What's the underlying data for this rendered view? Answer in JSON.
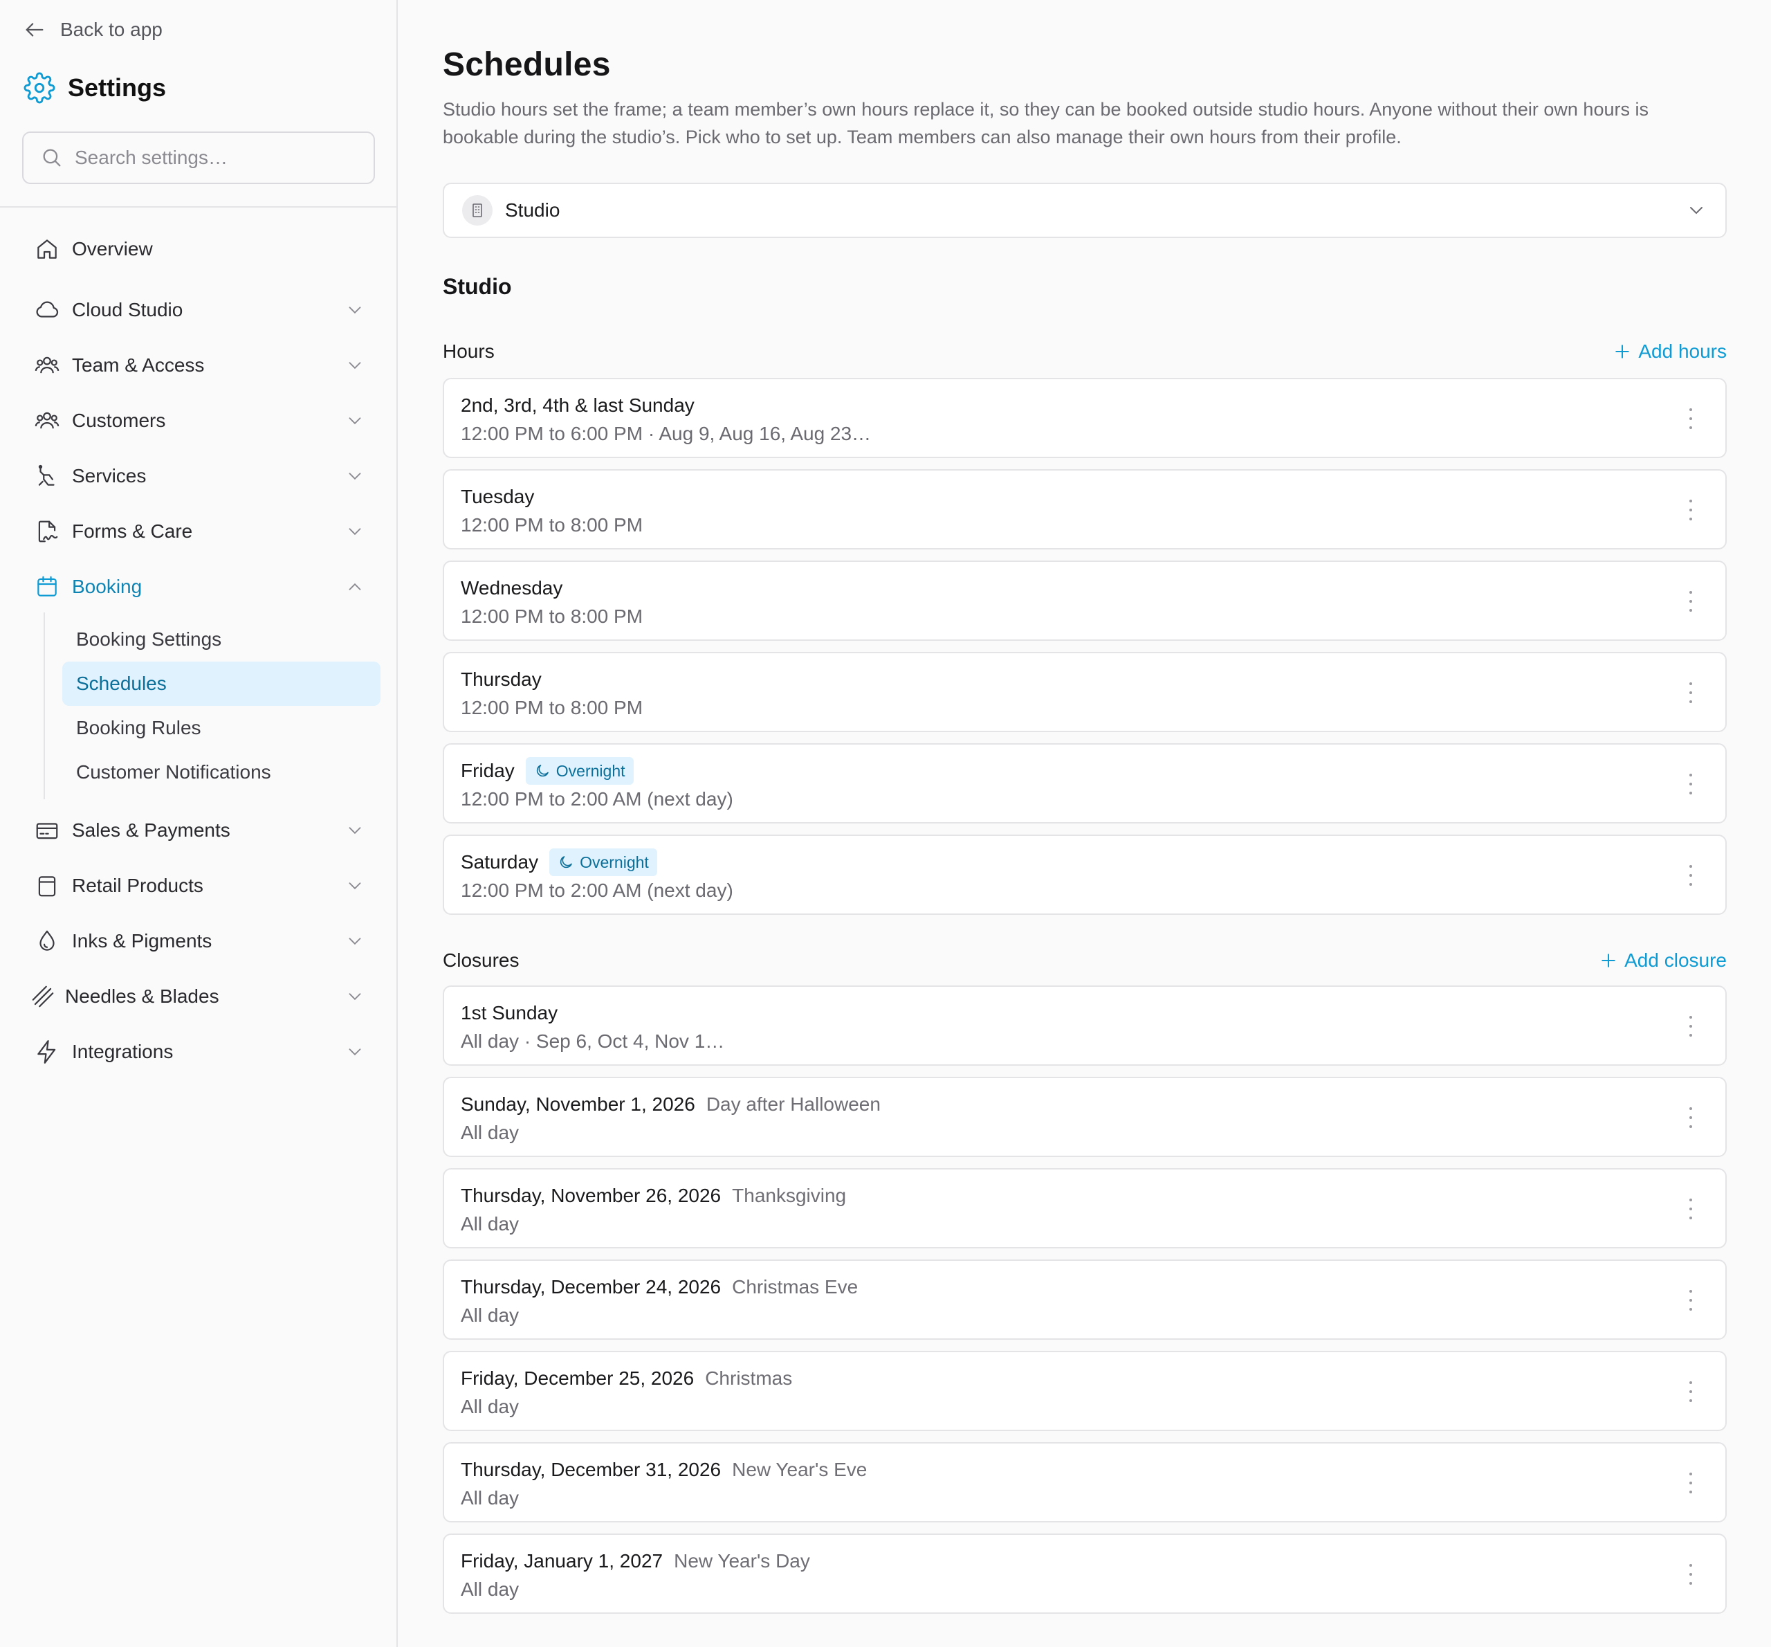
{
  "sidebar": {
    "back_label": "Back to app",
    "title": "Settings",
    "search_placeholder": "Search settings…",
    "items": [
      {
        "label": "Overview",
        "icon": "home-icon",
        "expandable": false
      },
      {
        "label": "Cloud Studio",
        "icon": "cloud-icon",
        "expandable": true
      },
      {
        "label": "Team & Access",
        "icon": "users-icon",
        "expandable": true
      },
      {
        "label": "Customers",
        "icon": "users-icon",
        "expandable": true
      },
      {
        "label": "Services",
        "icon": "tattoo-machine-icon",
        "expandable": true
      },
      {
        "label": "Forms & Care",
        "icon": "file-signature-icon",
        "expandable": true
      },
      {
        "label": "Booking",
        "icon": "calendar-icon",
        "expandable": true,
        "expanded": true,
        "active": true
      },
      {
        "label": "Sales & Payments",
        "icon": "credit-card-icon",
        "expandable": true
      },
      {
        "label": "Retail Products",
        "icon": "shopping-bag-icon",
        "expandable": true
      },
      {
        "label": "Inks & Pigments",
        "icon": "droplet-icon",
        "expandable": true
      },
      {
        "label": "Needles & Blades",
        "icon": "needles-icon",
        "expandable": true
      },
      {
        "label": "Integrations",
        "icon": "zap-icon",
        "expandable": true
      }
    ],
    "booking_subitems": [
      {
        "label": "Booking Settings"
      },
      {
        "label": "Schedules",
        "active": true
      },
      {
        "label": "Booking Rules"
      },
      {
        "label": "Customer Notifications"
      }
    ]
  },
  "main": {
    "title": "Schedules",
    "description": "Studio hours set the frame; a team member’s own hours replace it, so they can be booked outside studio hours. Anyone without their own hours is bookable during the studio’s. Pick who to set up. Team members can also manage their own hours from their profile.",
    "selector": {
      "value": "Studio",
      "icon": "building-icon"
    },
    "section_title": "Studio",
    "hours": {
      "label": "Hours",
      "action": "Add hours",
      "items": [
        {
          "title": "2nd, 3rd, 4th & last Sunday",
          "subtitle": "12:00 PM to 6:00 PM · Aug 9, Aug 16, Aug 23…"
        },
        {
          "title": "Tuesday",
          "subtitle": "12:00 PM to 8:00 PM"
        },
        {
          "title": "Wednesday",
          "subtitle": "12:00 PM to 8:00 PM"
        },
        {
          "title": "Thursday",
          "subtitle": "12:00 PM to 8:00 PM"
        },
        {
          "title": "Friday",
          "badge": "Overnight",
          "subtitle": "12:00 PM to 2:00 AM (next day)"
        },
        {
          "title": "Saturday",
          "badge": "Overnight",
          "subtitle": "12:00 PM to 2:00 AM (next day)"
        }
      ]
    },
    "closures": {
      "label": "Closures",
      "action": "Add closure",
      "items": [
        {
          "title": "1st Sunday",
          "subtitle": "All day · Sep 6, Oct 4, Nov 1…"
        },
        {
          "title": "Sunday, November 1, 2026",
          "note": "Day after Halloween",
          "subtitle": "All day"
        },
        {
          "title": "Thursday, November 26, 2026",
          "note": "Thanksgiving",
          "subtitle": "All day"
        },
        {
          "title": "Thursday, December 24, 2026",
          "note": "Christmas Eve",
          "subtitle": "All day"
        },
        {
          "title": "Friday, December 25, 2026",
          "note": "Christmas",
          "subtitle": "All day"
        },
        {
          "title": "Thursday, December 31, 2026",
          "note": "New Year's Eve",
          "subtitle": "All day"
        },
        {
          "title": "Friday, January 1, 2027",
          "note": "New Year's Day",
          "subtitle": "All day"
        }
      ]
    },
    "colors": {
      "accent": "#0e9bd4",
      "active_bg": "#e0f2fd",
      "active_text": "#0b6f9a"
    }
  }
}
